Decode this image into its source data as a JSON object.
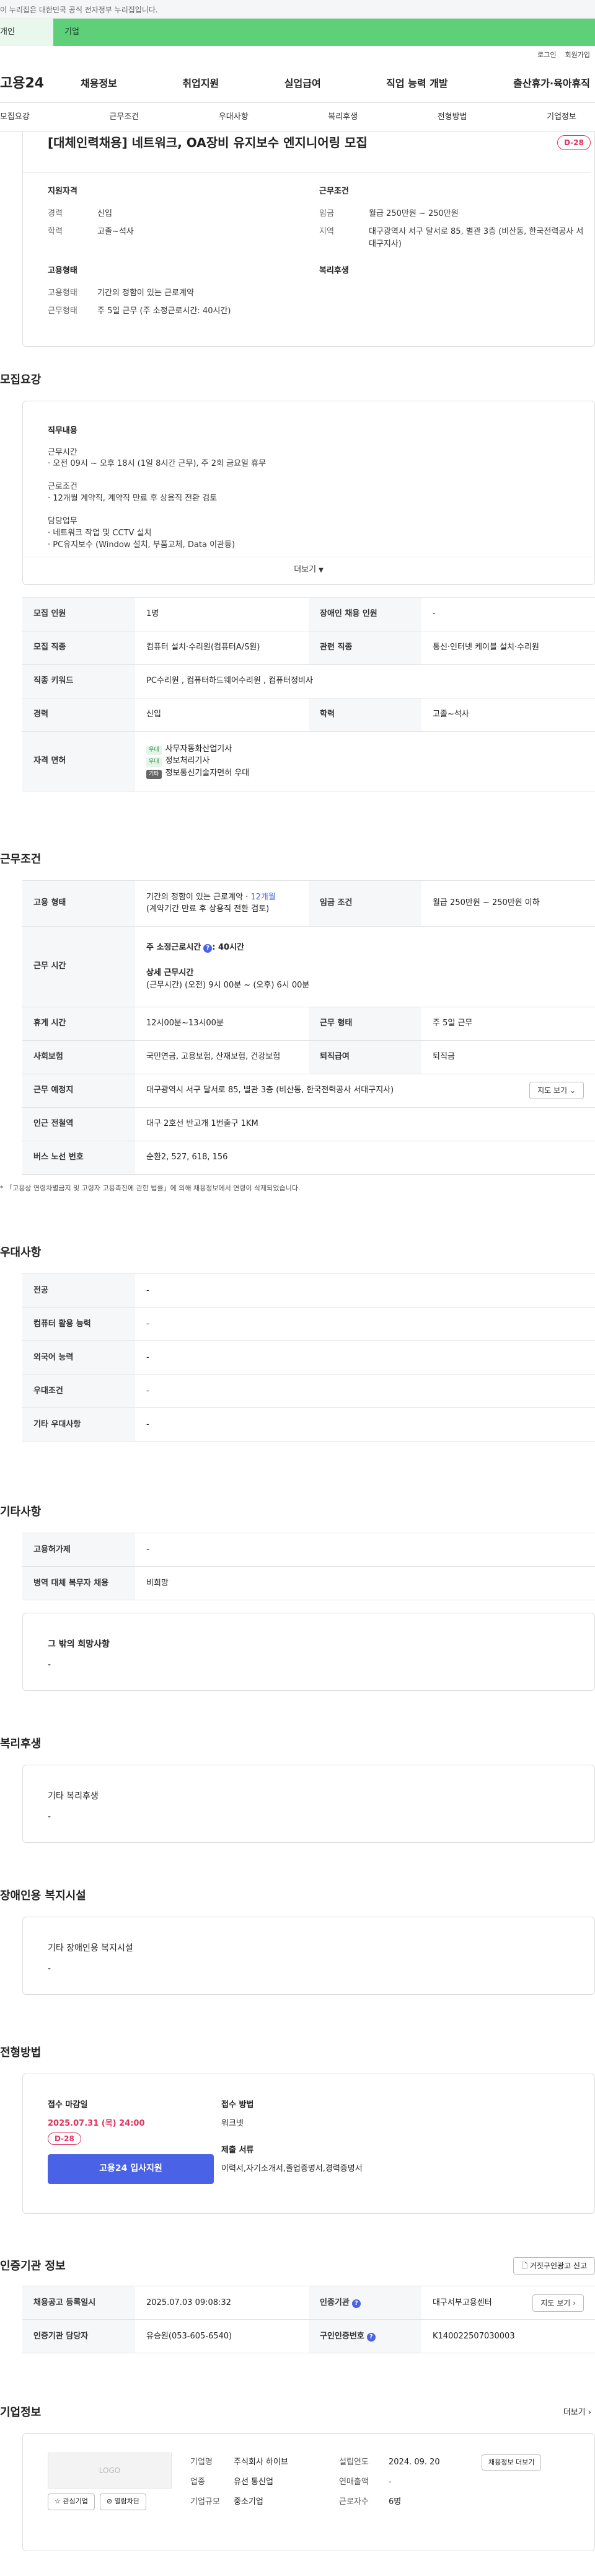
{
  "gov_banner": "이 누리집은 대한민국 공식 전자정부 누리집입니다.",
  "top_tabs": {
    "personal": "개인",
    "company": "기업"
  },
  "util": {
    "login": "로그인",
    "signup": "회원가입"
  },
  "logo": "고용24",
  "gnb": [
    "채용정보",
    "취업지원",
    "실업급여",
    "직업 능력 개발",
    "출산휴가·육아휴직"
  ],
  "subnav": [
    "모집요강",
    "근무조건",
    "우대사항",
    "복리후생",
    "전형방법",
    "기업정보"
  ],
  "header": {
    "title": "[대체인력채용] 네트워크, OA장비 유지보수 엔지니어링 모집",
    "dday": "D-28",
    "qual_title": "지원자격",
    "qual": [
      {
        "k": "경력",
        "v": "신입"
      },
      {
        "k": "학력",
        "v": "고졸~석사"
      }
    ],
    "work_title": "근무조건",
    "work": [
      {
        "k": "임금",
        "v": "월급 250만원 ~ 250만원"
      },
      {
        "k": "지역",
        "v": "대구광역시 서구 달서로 85, 별관 3층 (비산동, 한국전력공사 서대구지사)"
      }
    ],
    "emp_title": "고용형태",
    "emp": [
      {
        "k": "고용형태",
        "v": "기간의 정함이 있는 근로계약"
      },
      {
        "k": "근무형태",
        "v": "주 5일 근무 (주 소정근로시간: 40시간)"
      }
    ],
    "welfare_title": "복리후생"
  },
  "recruit": {
    "title": "모집요강",
    "detail_title": "직무내용",
    "detail": [
      "근무시간",
      "· 오전 09시 ~ 오후 18시 (1일 8시간 근무), 주 2회 금요일 휴무",
      "",
      "근로조건",
      "· 12개월 계약직, 계약직 만료 후 상용직 전환 검토",
      "",
      "담당업무",
      "· 네트워크 작업 및 CCTV 설치",
      "· PC유지보수 (Window 설치, 부품교체, Data 이관등)"
    ],
    "more": "더보기",
    "rows": {
      "count_k": "모집 인원",
      "count_v": "1명",
      "disabled_k": "장애인 채용 인원",
      "disabled_v": "-",
      "job_k": "모집 직종",
      "job_v": "컴퓨터 설치·수리원(컴퓨터A/S원)",
      "rel_k": "관련 직종",
      "rel_v": "통신·인터넷 케이블 설치·수리원",
      "kw_k": "직종 키워드",
      "kw_v": "PC수리원 , 컴퓨터하드웨어수리원 , 컴퓨터정비사",
      "career_k": "경력",
      "career_v": "신입",
      "edu_k": "학력",
      "edu_v": "고졸~석사",
      "lic_k": "자격 면허",
      "licenses": [
        {
          "tag": "우대",
          "name": "사무자동화산업기사"
        },
        {
          "tag": "우대",
          "name": "정보처리기사"
        },
        {
          "tag": "기타",
          "name": "정보통신기술자면허 우대"
        }
      ]
    }
  },
  "work": {
    "title": "근무조건",
    "emp_k": "고용 형태",
    "emp_v1": "기간의 정함이 있는 근로계약 · ",
    "emp_v1b": "12개월",
    "emp_v2": "(계약기간 만료 후 상용직 전환 검토)",
    "wage_k": "임금 조건",
    "wage_v": "월급 250만원 ~ 250만원 이하",
    "hours_k": "근무 시간",
    "hours_v1": "주 소정근로시간",
    "hours_v1b": ": 40시간",
    "hours_v2": "상세 근무시간",
    "hours_v3": "(근무시간) (오전) 9시 00분 ~ (오후) 6시 00분",
    "break_k": "휴게 시간",
    "break_v": "12시00분~13시00분",
    "type_k": "근무 형태",
    "type_v": "주 5일 근무",
    "ins_k": "사회보험",
    "ins_v": "국민연금, 고용보험, 산재보험, 건강보험",
    "ret_k": "퇴직급여",
    "ret_v": "퇴직금",
    "loc_k": "근무 예정지",
    "loc_v": "대구광역시 서구 달서로 85, 별관 3층 (비산동, 한국전력공사 서대구지사)",
    "map_btn": "지도 보기",
    "sub_k": "인근 전철역",
    "sub_v": "대구 2호선 반고개 1번출구 1KM",
    "bus_k": "버스 노선 번호",
    "bus_v": "순환2, 527, 618, 156",
    "note": "「고용상 연령차별금지 및 고령자 고용촉진에 관한 법률」에 의해 채용정보에서 연령이 삭제되었습니다."
  },
  "prefer": {
    "title": "우대사항",
    "rows": [
      {
        "k": "전공",
        "v": "-"
      },
      {
        "k": "컴퓨터 활용 능력",
        "v": "-"
      },
      {
        "k": "외국어 능력",
        "v": "-"
      },
      {
        "k": "우대조건",
        "v": "-"
      },
      {
        "k": "기타 우대사항",
        "v": "-"
      }
    ]
  },
  "etc": {
    "title": "기타사항",
    "rows": [
      {
        "k": "고용허가제",
        "v": "-"
      },
      {
        "k": "병역 대체 복무자 채용",
        "v": "비희망"
      }
    ],
    "wish_title": "그 밖의 희망사항",
    "wish_v": "-"
  },
  "welfare": {
    "title": "복리후생",
    "sub": "기타 복리후생",
    "v": "-"
  },
  "facility": {
    "title": "장애인용 복지시설",
    "sub": "기타 장애인용 복지시설",
    "v": "-"
  },
  "apply": {
    "title": "전형방법",
    "deadline_k": "접수 마감일",
    "deadline_v": "2025.07.31 (목) 24:00",
    "dday": "D-28",
    "btn": "고용24 입사지원",
    "method_k": "접수 방법",
    "method_v": "워크넷",
    "docs_k": "제출 서류",
    "docs_v": "이력서,자기소개서,졸업증명서,경력증명서"
  },
  "cert": {
    "title": "인증기관 정보",
    "report_btn": "거짓구인광고 신고",
    "reg_k": "채용공고 등록일시",
    "reg_v": "2025.07.03 09:08:32",
    "org_k": "인증기관",
    "org_v": "대구서부고용센터",
    "map_btn": "지도 보기",
    "mgr_k": "인증기관 담당자",
    "mgr_v": "유승원(053-605-6540)",
    "no_k": "구인인증번호",
    "no_v": "K140022507030003"
  },
  "company": {
    "title": "기업정보",
    "more": "더보기",
    "logo": "LOGO",
    "fav_btn": "관심기업",
    "block_btn": "열람차단",
    "name_k": "기업명",
    "name_v": "주식회사 하이브",
    "year_k": "설립연도",
    "year_v": "2024. 09. 20",
    "jobs_btn": "채용정보 더보기",
    "ind_k": "업종",
    "ind_v": "유선 통신업",
    "sales_k": "연매출액",
    "sales_v": "-",
    "size_k": "기업규모",
    "size_v": "중소기업",
    "emp_k": "근로자수",
    "emp_v": "6명"
  },
  "colors": {
    "accent": "#4a63e6",
    "dday": "#e0335e",
    "tab_green": "#5fd07a"
  }
}
